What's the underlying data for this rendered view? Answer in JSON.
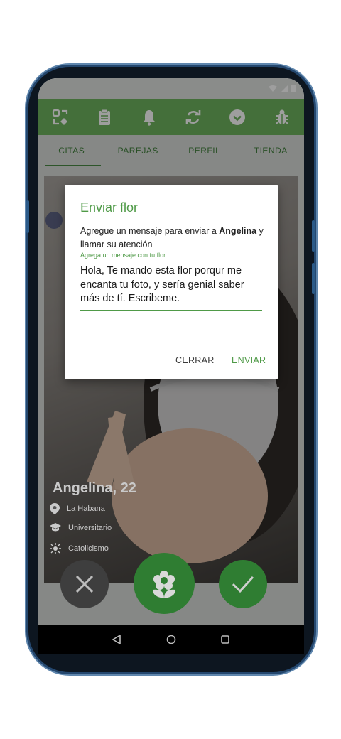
{
  "toolbar": {
    "icons": [
      "match-icon",
      "clipboard-icon",
      "bell-icon",
      "refresh-icon",
      "check-circle-icon",
      "bug-icon"
    ]
  },
  "tabs": [
    {
      "label": "CITAS"
    },
    {
      "label": "PAREJAS"
    },
    {
      "label": "PERFIL"
    },
    {
      "label": "TIENDA"
    }
  ],
  "profile": {
    "name": "Angelina, 22",
    "location": "La Habana",
    "education": "Universitario",
    "religion": "Catolicismo"
  },
  "dialog": {
    "title": "Enviar flor",
    "message_prefix": "Agregue un mensaje para enviar a ",
    "recipient": "Angelina",
    "message_suffix": " y llamar su atención",
    "hint": "Agrega un mensaje con tu flor",
    "input_value": "Hola, Te mando esta flor porqur me encanta tu foto, y sería genial saber más de tí. Escribeme.",
    "close_label": "CERRAR",
    "send_label": "ENVIAR"
  },
  "colors": {
    "primary": "#6fb45e",
    "accent": "#4f9a47",
    "fab_green": "#2f7d32",
    "fab_dark": "#3e3e3e"
  }
}
